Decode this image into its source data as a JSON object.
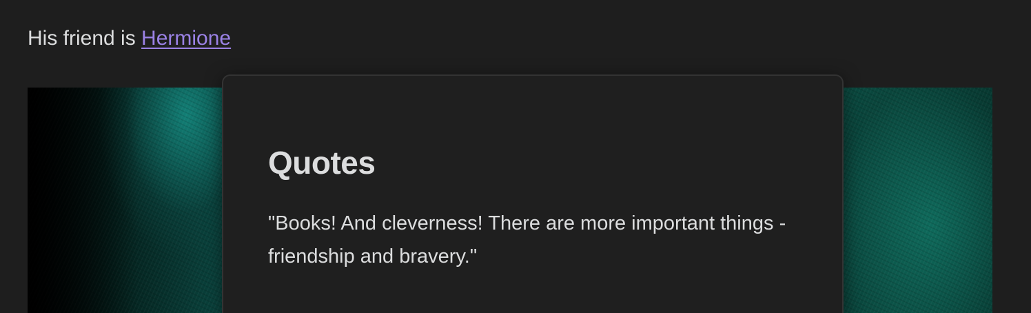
{
  "note": {
    "friend_prefix": "His friend is ",
    "friend_link": "Hermione"
  },
  "banner": {
    "colors": [
      "#000000",
      "#0b4a44",
      "#148c82"
    ]
  },
  "popover": {
    "title": "Quotes",
    "quote": "\"Books! And cleverness! There are more important things - friendship and bravery.\""
  },
  "theme": {
    "background": "#1e1e1e",
    "text": "#dcddde",
    "link": "#9b82e6"
  }
}
